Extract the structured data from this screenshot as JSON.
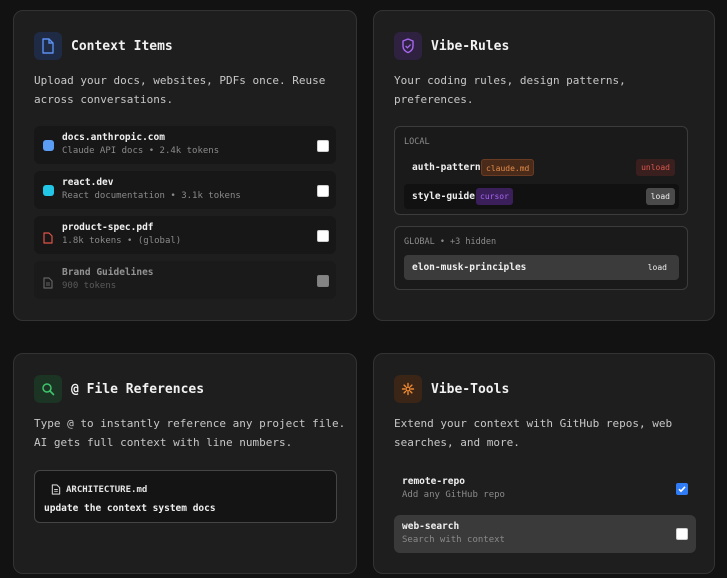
{
  "context_items": {
    "title": "Context Items",
    "icon": "file-icon",
    "desc_line1": "Upload your docs, websites, PDFs once. Reuse",
    "desc_line2": "across conversations.",
    "items": [
      {
        "name": "docs.anthropic.com",
        "detail": "Claude API docs • 2.4k tokens",
        "color": "#5b9cf5",
        "checked": true
      },
      {
        "name": "react.dev",
        "detail": "React documentation • 3.1k tokens",
        "color": "#22c6e6",
        "checked": true
      },
      {
        "name": "product-spec.pdf",
        "detail": "1.8k tokens  • (global)",
        "icon": "pdf-file-icon",
        "checked": true
      },
      {
        "name": "Brand Guidelines",
        "detail": "900 tokens",
        "icon": "document-icon",
        "checked": false
      }
    ]
  },
  "vibe_rules": {
    "title": "Vibe-Rules",
    "icon": "shield-icon",
    "desc_line1": "Your coding rules, design patterns,",
    "desc_line2": "preferences.",
    "local": {
      "header": "LOCAL",
      "rules": [
        {
          "name": "auth-pattern",
          "tag": "claude.md",
          "action": "unload"
        },
        {
          "name": "style-guide",
          "tag": "cursor",
          "action": "load"
        }
      ]
    },
    "global": {
      "header": "GLOBAL • +3 hidden",
      "rules": [
        {
          "name": "elon-musk-principles",
          "action": "load"
        }
      ]
    }
  },
  "file_references": {
    "title": "@ File References",
    "icon": "search-icon",
    "desc_line1": "Type @ to instantly reference any project file.",
    "desc_line2": "AI gets full context with line numbers.",
    "file_chip": "ARCHITECTURE.md",
    "prompt_text": "update the context system docs"
  },
  "vibe_tools": {
    "title": "Vibe-Tools",
    "icon": "gear-icon",
    "desc_line1": "Extend your context with GitHub repos, web",
    "desc_line2": "searches, and more.",
    "tools": [
      {
        "name": "remote-repo",
        "detail": "Add any GitHub repo",
        "checked": true
      },
      {
        "name": "web-search",
        "detail": "Search with context",
        "checked": false
      }
    ]
  },
  "colors": {
    "accent_blue": "#2f7cf6",
    "rules_purple": "#a866f0",
    "files_green": "#3fc56b",
    "tools_orange": "#f08a32",
    "unload_red": "#d9574c",
    "claude_orange": "#e08a4a"
  }
}
